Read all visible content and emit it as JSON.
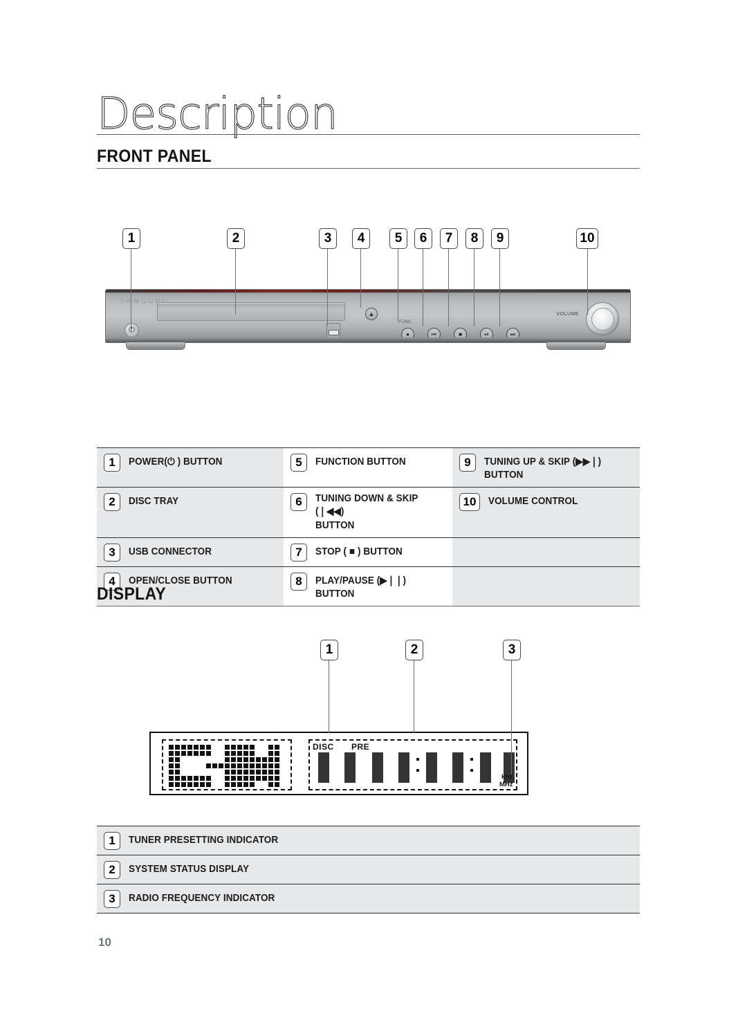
{
  "document": {
    "chapter_title": "Description",
    "page_number": "10"
  },
  "sections": {
    "front_panel": {
      "heading": "FRONT PANEL",
      "diagram_callouts": [
        "1",
        "2",
        "3",
        "4",
        "5",
        "6",
        "7",
        "8",
        "9",
        "10"
      ],
      "device": {
        "brand": "SAMSUNG",
        "volume_label": "VOLUME",
        "func_label": "FUNC.",
        "power_icon": "power-icon",
        "eject_icon": "eject-icon",
        "usb_icon": "usb-icon",
        "transport_icons": [
          "func-dot-icon",
          "skip-back-icon",
          "stop-icon",
          "play-pause-icon",
          "skip-forward-icon"
        ]
      },
      "table": [
        {
          "col1": {
            "num": "1",
            "label": "POWER(⏻ ) BUTTON"
          },
          "col2": {
            "num": "5",
            "label": "FUNCTION BUTTON"
          },
          "col3": {
            "num": "9",
            "label": "TUNING UP & SKIP (▶▶❘) BUTTON"
          }
        },
        {
          "col1": {
            "num": "2",
            "label": "DISC TRAY"
          },
          "col2": {
            "num": "6",
            "label": "TUNING DOWN & SKIP (❘◀◀)\nBUTTON"
          },
          "col3": {
            "num": "10",
            "label": "VOLUME CONTROL"
          }
        },
        {
          "col1": {
            "num": "3",
            "label": "USB CONNECTOR"
          },
          "col2": {
            "num": "7",
            "label": "STOP ( ■ ) BUTTON"
          },
          "col3": {
            "num": "",
            "label": ""
          }
        },
        {
          "col1": {
            "num": "4",
            "label": "OPEN/CLOSE BUTTON"
          },
          "col2": {
            "num": "8",
            "label": "PLAY/PAUSE (▶❘❘) BUTTON"
          },
          "col3": {
            "num": "",
            "label": ""
          }
        }
      ]
    },
    "display": {
      "heading": "DISPLAY",
      "diagram_callouts": [
        "1",
        "2",
        "3"
      ],
      "vfd": {
        "labels": {
          "disc": "DISC",
          "pre": "PRE",
          "khz": "kHz",
          "mhz": "MHz"
        }
      },
      "table": [
        {
          "num": "1",
          "label": "TUNER PRESETTING INDICATOR"
        },
        {
          "num": "2",
          "label": "SYSTEM STATUS DISPLAY"
        },
        {
          "num": "3",
          "label": "RADIO FREQUENCY INDICATOR"
        }
      ]
    }
  },
  "colors": {
    "rule": "#6b6b6b",
    "table_border": "#2d2d2d",
    "row_gray": "#e7e8ea",
    "page_number": "#6d7475"
  }
}
